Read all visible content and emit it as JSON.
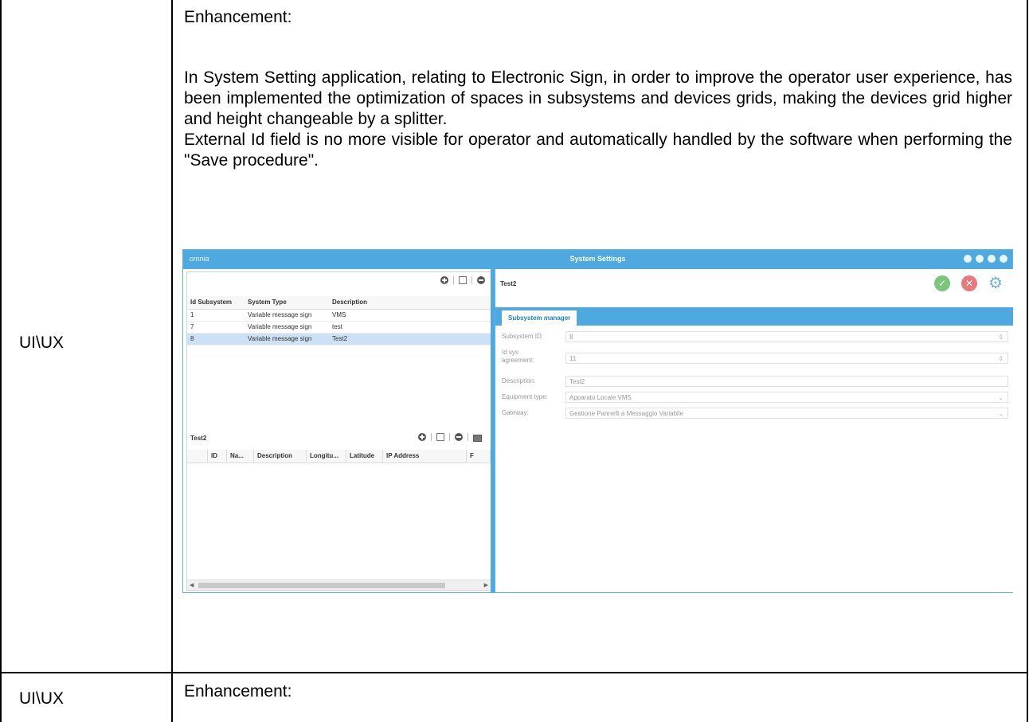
{
  "rows": [
    {
      "category": "UI\\UX",
      "heading": "Enhancement:",
      "paragraphs": [
        "In System Setting application, relating to Electronic Sign, in order to improve the operator user experience, has been implemented the optimization of spaces in subsystems and devices grids, making the devices grid higher and height changeable by a splitter.",
        "External Id field is no more visible for operator and automatically handled by the software when performing the \"Save procedure\"."
      ]
    },
    {
      "category": "UI\\UX",
      "heading": "Enhancement:"
    }
  ],
  "screenshot": {
    "brand": "omnia",
    "window_title": "System Settings",
    "subsystem_grid": {
      "columns": [
        "Id Subsystem",
        "System Type",
        "Description"
      ],
      "rows": [
        [
          "1",
          "Variable message sign",
          "VMS"
        ],
        [
          "7",
          "Variable message sign",
          "test"
        ],
        [
          "8",
          "Variable message sign",
          "Test2"
        ]
      ],
      "selected_index": 2
    },
    "devices_grid": {
      "title": "Test2",
      "columns": [
        "ID",
        "Na...",
        "Description",
        "Longitu...",
        "Latitude",
        "IP Address",
        "F"
      ]
    },
    "detail": {
      "title": "Test2",
      "tab": "Subsystem manager",
      "fields": [
        {
          "label": "Subsystem ID:",
          "value": "8"
        },
        {
          "label": "Id sys agreement:",
          "value": "11"
        },
        {
          "label": "Description:",
          "value": "Test2"
        },
        {
          "label": "Equipment type:",
          "value": "Apparato Locale VMS"
        },
        {
          "label": "Gateway:",
          "value": "Gestione Pannelli a Messaggio Variabile"
        }
      ]
    }
  }
}
